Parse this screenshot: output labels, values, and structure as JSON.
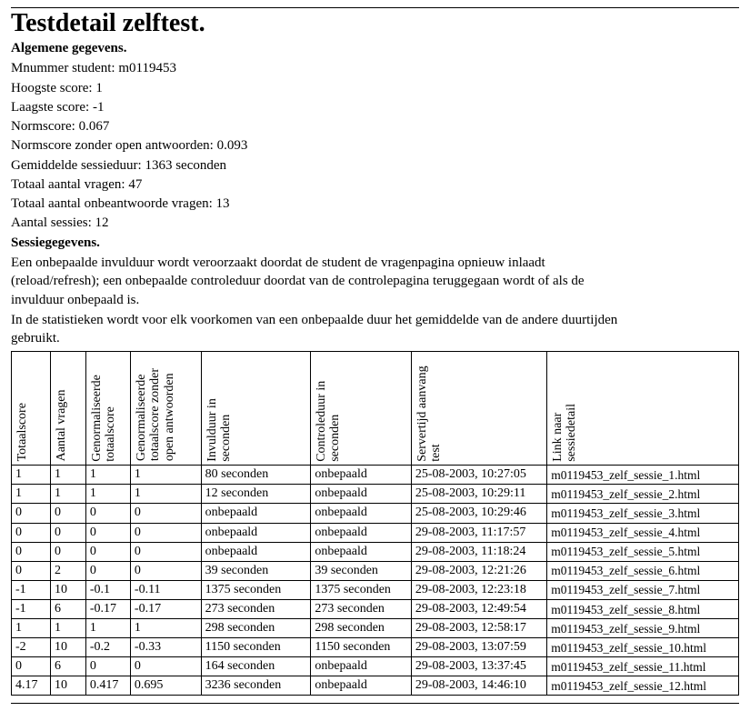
{
  "title": "Testdetail zelftest.",
  "section_general": "Algemene gegevens.",
  "general": {
    "mnummer_label": "Mnummer student:",
    "mnummer": "m0119453",
    "hoogste_label": "Hoogste score:",
    "hoogste": "1",
    "laagste_label": "Laagste score:",
    "laagste": "-1",
    "normscore_label": "Normscore:",
    "normscore": "0.067",
    "normscore_zopen_label": "Normscore zonder open antwoorden:",
    "normscore_zopen": "0.093",
    "gem_sessieduur_label": "Gemiddelde sessieduur:",
    "gem_sessieduur": "1363 seconden",
    "totaal_vragen_label": "Totaal aantal vragen:",
    "totaal_vragen": "47",
    "totaal_onbeantwoord_label": "Totaal aantal onbeantwoorde vragen:",
    "totaal_onbeantwoord": "13",
    "aantal_sessies_label": "Aantal sessies:",
    "aantal_sessies": "12"
  },
  "section_session": "Sessiegegevens.",
  "para1": "Een onbepaalde invulduur wordt veroorzaakt doordat de student de vragenpagina opnieuw inlaadt (reload/refresh); een onbepaalde controleduur doordat van de controlepagina teruggegaan wordt of als de invulduur onbepaald is.",
  "para2": "In de statistieken wordt voor elk voorkomen van een onbepaalde duur het gemiddelde van de andere duurtijden gebruikt.",
  "headers": {
    "c1": "Totaalscore",
    "c2": "Aantal vragen",
    "c3": "Genormaliseerde totaalscore",
    "c4": "Genormaliseerde totaalscore zonder open antwoorden",
    "c5": "Invulduur in seconden",
    "c6": "Controleduur in seconden",
    "c7": "Servertijd aanvang test",
    "c8": "Link naar sessiedetail"
  },
  "rows": [
    {
      "totaal": "1",
      "vragen": "1",
      "norm": "1",
      "norm_zo": "1",
      "invul": "80 seconden",
      "control": "onbepaald",
      "tijd": "25-08-2003, 10:27:05",
      "link": "m0119453_zelf_sessie_1.html"
    },
    {
      "totaal": "1",
      "vragen": "1",
      "norm": "1",
      "norm_zo": "1",
      "invul": "12 seconden",
      "control": "onbepaald",
      "tijd": "25-08-2003, 10:29:11",
      "link": "m0119453_zelf_sessie_2.html"
    },
    {
      "totaal": "0",
      "vragen": "0",
      "norm": "0",
      "norm_zo": "0",
      "invul": "onbepaald",
      "control": "onbepaald",
      "tijd": "25-08-2003, 10:29:46",
      "link": "m0119453_zelf_sessie_3.html"
    },
    {
      "totaal": "0",
      "vragen": "0",
      "norm": "0",
      "norm_zo": "0",
      "invul": "onbepaald",
      "control": "onbepaald",
      "tijd": "29-08-2003, 11:17:57",
      "link": "m0119453_zelf_sessie_4.html"
    },
    {
      "totaal": "0",
      "vragen": "0",
      "norm": "0",
      "norm_zo": "0",
      "invul": "onbepaald",
      "control": "onbepaald",
      "tijd": "29-08-2003, 11:18:24",
      "link": "m0119453_zelf_sessie_5.html"
    },
    {
      "totaal": "0",
      "vragen": "2",
      "norm": "0",
      "norm_zo": "0",
      "invul": "39 seconden",
      "control": "39 seconden",
      "tijd": "29-08-2003, 12:21:26",
      "link": "m0119453_zelf_sessie_6.html"
    },
    {
      "totaal": "-1",
      "vragen": "10",
      "norm": "-0.1",
      "norm_zo": "-0.11",
      "invul": "1375 seconden",
      "control": "1375 seconden",
      "tijd": "29-08-2003, 12:23:18",
      "link": "m0119453_zelf_sessie_7.html"
    },
    {
      "totaal": "-1",
      "vragen": "6",
      "norm": "-0.17",
      "norm_zo": "-0.17",
      "invul": "273 seconden",
      "control": "273 seconden",
      "tijd": "29-08-2003, 12:49:54",
      "link": "m0119453_zelf_sessie_8.html"
    },
    {
      "totaal": "1",
      "vragen": "1",
      "norm": "1",
      "norm_zo": "1",
      "invul": "298 seconden",
      "control": "298 seconden",
      "tijd": "29-08-2003, 12:58:17",
      "link": "m0119453_zelf_sessie_9.html"
    },
    {
      "totaal": "-2",
      "vragen": "10",
      "norm": "-0.2",
      "norm_zo": "-0.33",
      "invul": "1150 seconden",
      "control": "1150 seconden",
      "tijd": "29-08-2003, 13:07:59",
      "link": "m0119453_zelf_sessie_10.html"
    },
    {
      "totaal": "0",
      "vragen": "6",
      "norm": "0",
      "norm_zo": "0",
      "invul": "164 seconden",
      "control": "onbepaald",
      "tijd": "29-08-2003, 13:37:45",
      "link": "m0119453_zelf_sessie_11.html"
    },
    {
      "totaal": "4.17",
      "vragen": "10",
      "norm": "0.417",
      "norm_zo": "0.695",
      "invul": "3236 seconden",
      "control": "onbepaald",
      "tijd": "29-08-2003, 14:46:10",
      "link": "m0119453_zelf_sessie_12.html"
    }
  ]
}
